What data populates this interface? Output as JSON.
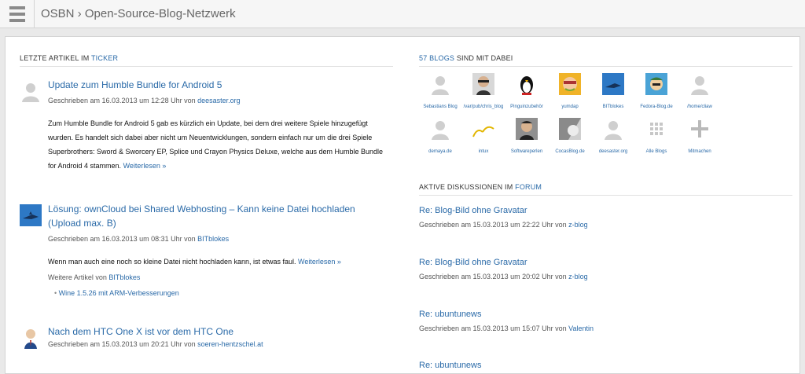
{
  "header": {
    "title": "OSBN › Open-Source-Blog-Netzwerk",
    "menu_icon": "hamburger-icon"
  },
  "left": {
    "heading_prefix": "LETZTE ARTIKEL IM ",
    "heading_link": "TICKER",
    "articles": [
      {
        "title": "Update zum Humble Bundle for Android 5",
        "meta_prefix": "Geschrieben am 16.03.2013 um 12:28 Uhr von ",
        "author": "deesaster.org",
        "body": "Zum Humble Bundle for Android 5 gab es kürzlich ein Update, bei dem drei weitere Spiele hinzugefügt wurden. Es handelt sich dabei aber nicht um Neuentwicklungen, sondern einfach nur um die drei Spiele Superbrothers: Sword & Sworcery EP, Splice und Crayon Physics Deluxe, welche aus dem Humble Bundle for Android 4 stammen.",
        "more": "Weiterlesen »"
      },
      {
        "title": "Lösung: ownCloud bei Shared Webhosting – Kann keine Datei hochladen (Upload max. B)",
        "meta_prefix": "Geschrieben am 16.03.2013 um 08:31 Uhr von ",
        "author": "BITblokes",
        "body": "Wenn man auch eine noch so kleine Datei nicht hochladen kann, ist etwas faul.",
        "more": "Weiterlesen »",
        "further_prefix": "Weitere Artikel von ",
        "further_author": "BITblokes",
        "related": "Wine 1.5.26 mit ARM-Verbesserungen"
      },
      {
        "title": "Nach dem HTC One X ist vor dem HTC One",
        "meta_prefix": "Geschrieben am 15.03.2013 um 20:21 Uhr von ",
        "author": "soeren-hentzschel.at"
      }
    ]
  },
  "right": {
    "blogs_heading_link": "57 BLOGS",
    "blogs_heading_suffix": " SIND MIT DABEI",
    "blogs": [
      "Sebastians Blog",
      "/var/pub/chris_blog",
      "Pinguinzubehör",
      "yumdap",
      "BITblokes",
      "Fedora-Blog.de",
      "/home/cliaw",
      "demaya.de",
      "intux",
      "Softwareperlen",
      "CocasBlog.de",
      "deesaster.org",
      "Alle Blogs",
      "Mitmachen"
    ],
    "forum_heading_prefix": "AKTIVE DISKUSSIONEN IM ",
    "forum_heading_link": "FORUM",
    "discussions": [
      {
        "title": "Re: Blog-Bild ohne Gravatar",
        "meta_prefix": "Geschrieben am 15.03.2013 um 22:22 Uhr von ",
        "author": "z-blog"
      },
      {
        "title": "Re: Blog-Bild ohne Gravatar",
        "meta_prefix": "Geschrieben am 15.03.2013 um 20:02 Uhr von ",
        "author": "z-blog"
      },
      {
        "title": "Re: ubuntunews",
        "meta_prefix": "Geschrieben am 15.03.2013 um 15:07 Uhr von ",
        "author": "Valentin"
      },
      {
        "title": "Re: ubuntunews"
      }
    ]
  }
}
